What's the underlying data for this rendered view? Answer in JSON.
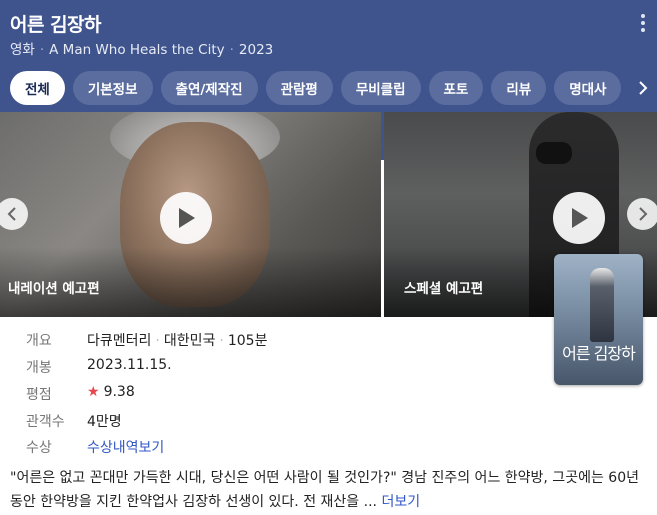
{
  "header": {
    "title": "어른 김장하",
    "meta": [
      "영화",
      "A Man Who Heals the City",
      "2023"
    ],
    "more_icon": "more-vertical-icon"
  },
  "tabs": [
    {
      "label": "전체",
      "active": true
    },
    {
      "label": "기본정보",
      "active": false
    },
    {
      "label": "출연/제작진",
      "active": false
    },
    {
      "label": "관람평",
      "active": false
    },
    {
      "label": "무비클립",
      "active": false
    },
    {
      "label": "포토",
      "active": false
    },
    {
      "label": "리뷰",
      "active": false
    },
    {
      "label": "명대사",
      "active": false
    }
  ],
  "videos": [
    {
      "label": "내레이션 예고편"
    },
    {
      "label": "스페셜 예고편"
    }
  ],
  "poster": {
    "title": "어른 김장하"
  },
  "info": {
    "rows": [
      {
        "label": "개요",
        "values": [
          "다큐멘터리",
          "대한민국",
          "105분"
        ]
      },
      {
        "label": "개봉",
        "value": "2023.11.15."
      },
      {
        "label": "평점",
        "value": "9.38"
      },
      {
        "label": "관객수",
        "value": "4만명"
      },
      {
        "label": "수상",
        "value": "수상내역보기"
      }
    ]
  },
  "synopsis": {
    "text": "\"어른은 없고 꼰대만 가득한 시대, 당신은 어떤 사람이 될 것인가?\" 경남 진주의 어느 한약방, 그곳에는 60년 동안 한약방을 지킨 한약업사 김장하 선생이 있다. 전 재산을 ...",
    "more": "더보기"
  },
  "colors": {
    "header_bg": "#3f548d",
    "accent_link": "#3057c4",
    "star": "#e8454f"
  }
}
